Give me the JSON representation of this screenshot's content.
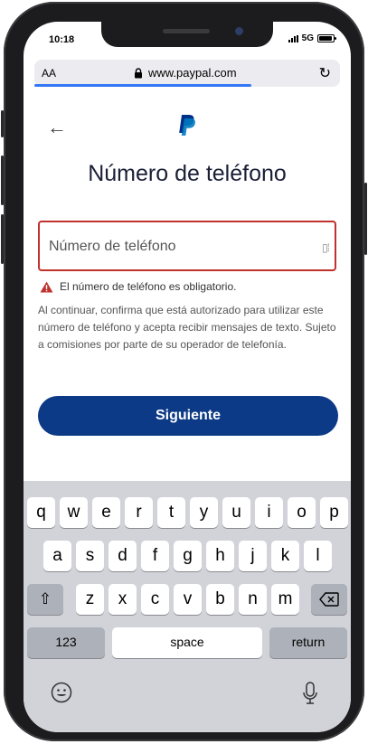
{
  "status_bar": {
    "time": "10:18",
    "network": "5G"
  },
  "browser": {
    "aa_label": "AA",
    "url": "www.paypal.com",
    "reload_icon": "reload-icon",
    "lock_icon": "lock-icon"
  },
  "page": {
    "back_icon": "arrow-left-icon",
    "logo_icon": "paypal-logo-icon",
    "title": "Número de teléfono",
    "field_label": "Número de teléfono",
    "field_icon": "contact-autofill-icon",
    "error_message": "El número de teléfono es obligatorio.",
    "consent_text": "Al continuar, confirma que está autorizado para utilizar este número de teléfono y acepta recibir mensajes de texto. Sujeto a comisiones por parte de su operador de telefonía.",
    "next_button": "Siguiente"
  },
  "keyboard": {
    "row1": [
      "q",
      "w",
      "e",
      "r",
      "t",
      "y",
      "u",
      "i",
      "o",
      "p"
    ],
    "row2": [
      "a",
      "s",
      "d",
      "f",
      "g",
      "h",
      "j",
      "k",
      "l"
    ],
    "row3": [
      "z",
      "x",
      "c",
      "v",
      "b",
      "n",
      "m"
    ],
    "shift_icon": "shift-icon",
    "backspace_icon": "backspace-icon",
    "numbers_label": "123",
    "space_label": "space",
    "return_label": "return",
    "emoji_icon": "emoji-icon",
    "mic_icon": "microphone-icon"
  },
  "colors": {
    "primary": "#0c3a86",
    "error": "#c0312c",
    "title": "#1a1f36",
    "progress": "#3478f6"
  }
}
